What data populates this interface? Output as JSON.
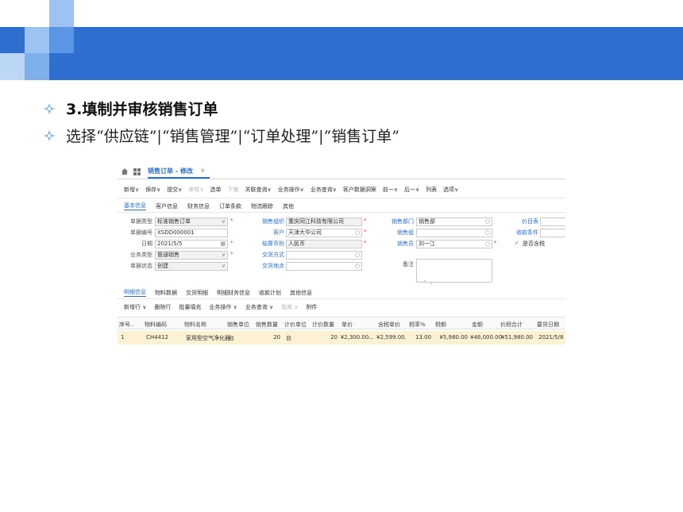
{
  "slide": {
    "bullet1": "3.填制并审核销售订单",
    "bullet2": "选择“供应链”|“销售管理”|“订单处理”|“销售订单”",
    "colors": {
      "band": "#2f6fcf",
      "accent": "#2a6fd6",
      "bullet": "#5b9bd5"
    }
  },
  "app": {
    "tab_title": "销售订单 - 修改",
    "close_glyph": "×",
    "toolbar": [
      "新增∨",
      "保存∨",
      "提交∨",
      "审核∨",
      "选单",
      "下推",
      "关联查询∨",
      "业务操作∨",
      "业务查询∨",
      "客户数据洞察",
      "前一∨",
      "后一∨",
      "列表",
      "选项∨"
    ],
    "toolbar_disabled": [
      "审核∨",
      "下推"
    ],
    "subtabs": [
      "基本信息",
      "客户信息",
      "财务信息",
      "订单条款",
      "物流跟踪",
      "其他"
    ],
    "form": {
      "doc_type_label": "单据类型",
      "doc_type": "标准销售订单",
      "doc_no_label": "单据编号",
      "doc_no": "XSDD000001",
      "date_label": "日期",
      "date": "2021/5/5",
      "biz_type_label": "业务类型",
      "biz_type": "普通销售",
      "status_label": "单据状态",
      "status": "创建",
      "sales_org_label": "销售组织",
      "sales_org": "重庆同江科技有限公司",
      "customer_label": "客户",
      "customer": "天津大华公司",
      "currency_label": "结算币别",
      "currency": "人民币",
      "delivery_method_label": "交货方式",
      "delivery_place_label": "交货地点",
      "sales_dept_label": "销售部门",
      "sales_dept": "销售部",
      "sales_group_label": "销售组",
      "salesman_label": "销售员",
      "salesman": "刘一江",
      "memo_label": "备注",
      "price_list_label": "价目表",
      "payment_terms_label": "收款条件",
      "tax_included_label": "是否含税",
      "tax_included_check": "✓"
    },
    "detail_tabs": [
      "明细信息",
      "物料数据",
      "交货明细",
      "明细财务信息",
      "收款计划",
      "其他信息"
    ],
    "detail_toolbar": [
      "新增行 ∨",
      "删除行",
      "批量填充",
      "业务操作 ∨",
      "业务查询 ∨",
      "临库 ∨",
      "附件"
    ],
    "detail_toolbar_disabled": [
      "临库 ∨"
    ],
    "table": {
      "headers": [
        "序号..",
        "物料编码",
        "物料名称",
        "销售单位",
        "销售数量",
        "计价单位",
        "计价数量",
        "单价",
        "含税单价",
        "税率%",
        "税额",
        "金额",
        "价税合计",
        "要货日期"
      ],
      "rows": [
        [
          "1",
          "CH4412",
          "家用型空气净化器",
          "台",
          "20",
          "台",
          "20",
          "¥2,300.00...",
          "¥2,599.00.",
          "13.00",
          "¥5,980.00",
          "¥46,000.00",
          "¥51,980.00",
          "2021/5/8 ."
        ]
      ]
    }
  }
}
